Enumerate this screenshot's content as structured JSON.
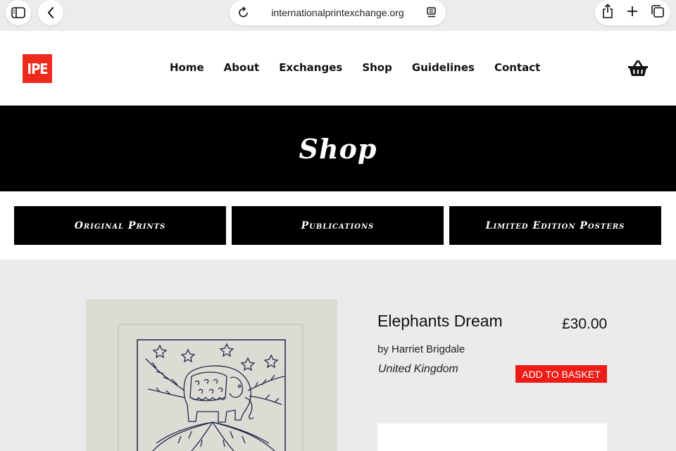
{
  "browser": {
    "url": "internationalprintexchange.org"
  },
  "site": {
    "logo_text": "IPE",
    "nav": [
      {
        "label": "Home"
      },
      {
        "label": "About"
      },
      {
        "label": "Exchanges"
      },
      {
        "label": "Shop"
      },
      {
        "label": "Guidelines"
      },
      {
        "label": "Contact"
      }
    ]
  },
  "banner": {
    "title": "Shop"
  },
  "categories": [
    {
      "label": "Original Prints"
    },
    {
      "label": "Publications"
    },
    {
      "label": "Limited Edition Posters"
    }
  ],
  "product": {
    "title": "Elephants Dream",
    "price": "£30.00",
    "artist": "by Harriet Brigdale",
    "country": "United Kingdom",
    "add_label": "ADD TO BASKET"
  },
  "colors": {
    "brand_red": "#ee2a1c",
    "button_red": "#ee1c16",
    "banner_black": "#000000",
    "page_bg": "#ebebeb"
  },
  "icons": [
    "sidebar-icon",
    "back-icon",
    "reload-icon",
    "reader-icon",
    "share-icon",
    "new-tab-icon",
    "tabs-icon",
    "basket-icon"
  ]
}
